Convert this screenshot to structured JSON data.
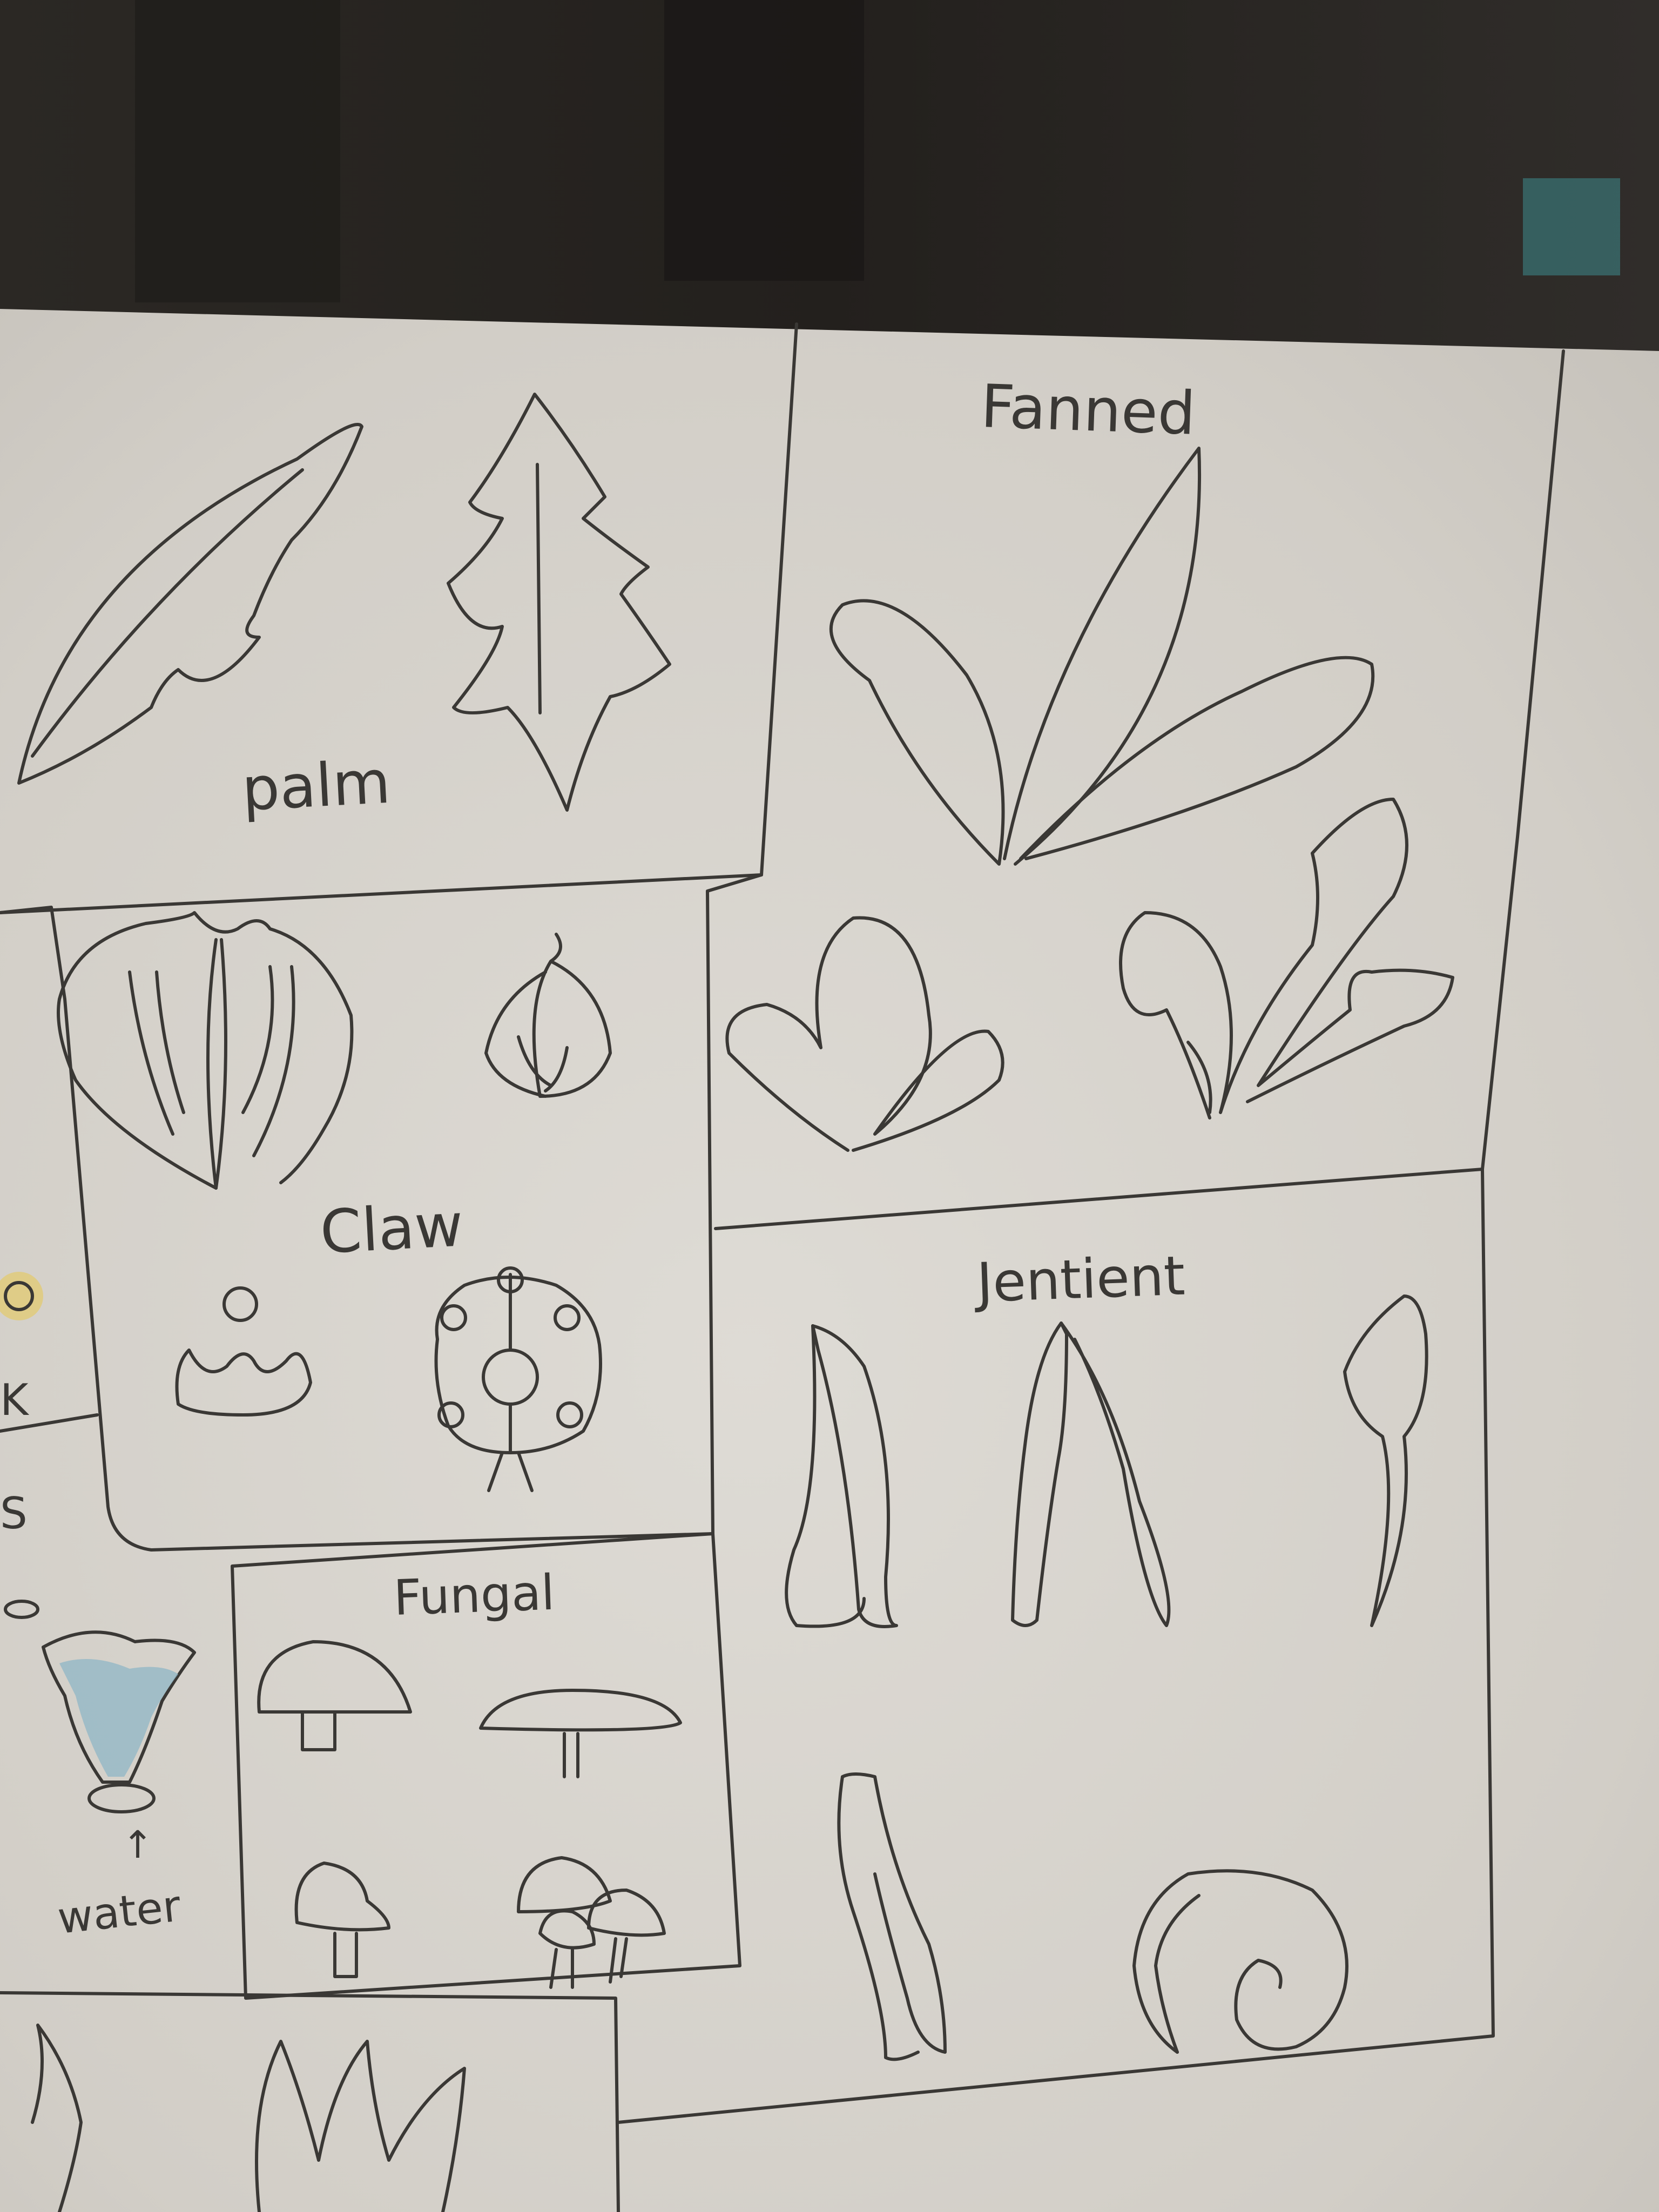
{
  "photo": {
    "subject": "hand-drawn plant concept sheet",
    "colors": {
      "background_dark": "#2a2723",
      "paper": "#dcd9d3",
      "paper_shadow": "#c9c5be",
      "ink": "#3a3835",
      "water_blue": "#8fb6c6",
      "yellow": "#e6c85a"
    }
  },
  "labels": {
    "palm": "palm",
    "fanned": "Fanned",
    "claw": "Claw",
    "sentient": "Jentient",
    "fungal": "Fungal",
    "water": "water",
    "water_arrow": "↑",
    "edge_k": "K",
    "edge_s": "S"
  }
}
